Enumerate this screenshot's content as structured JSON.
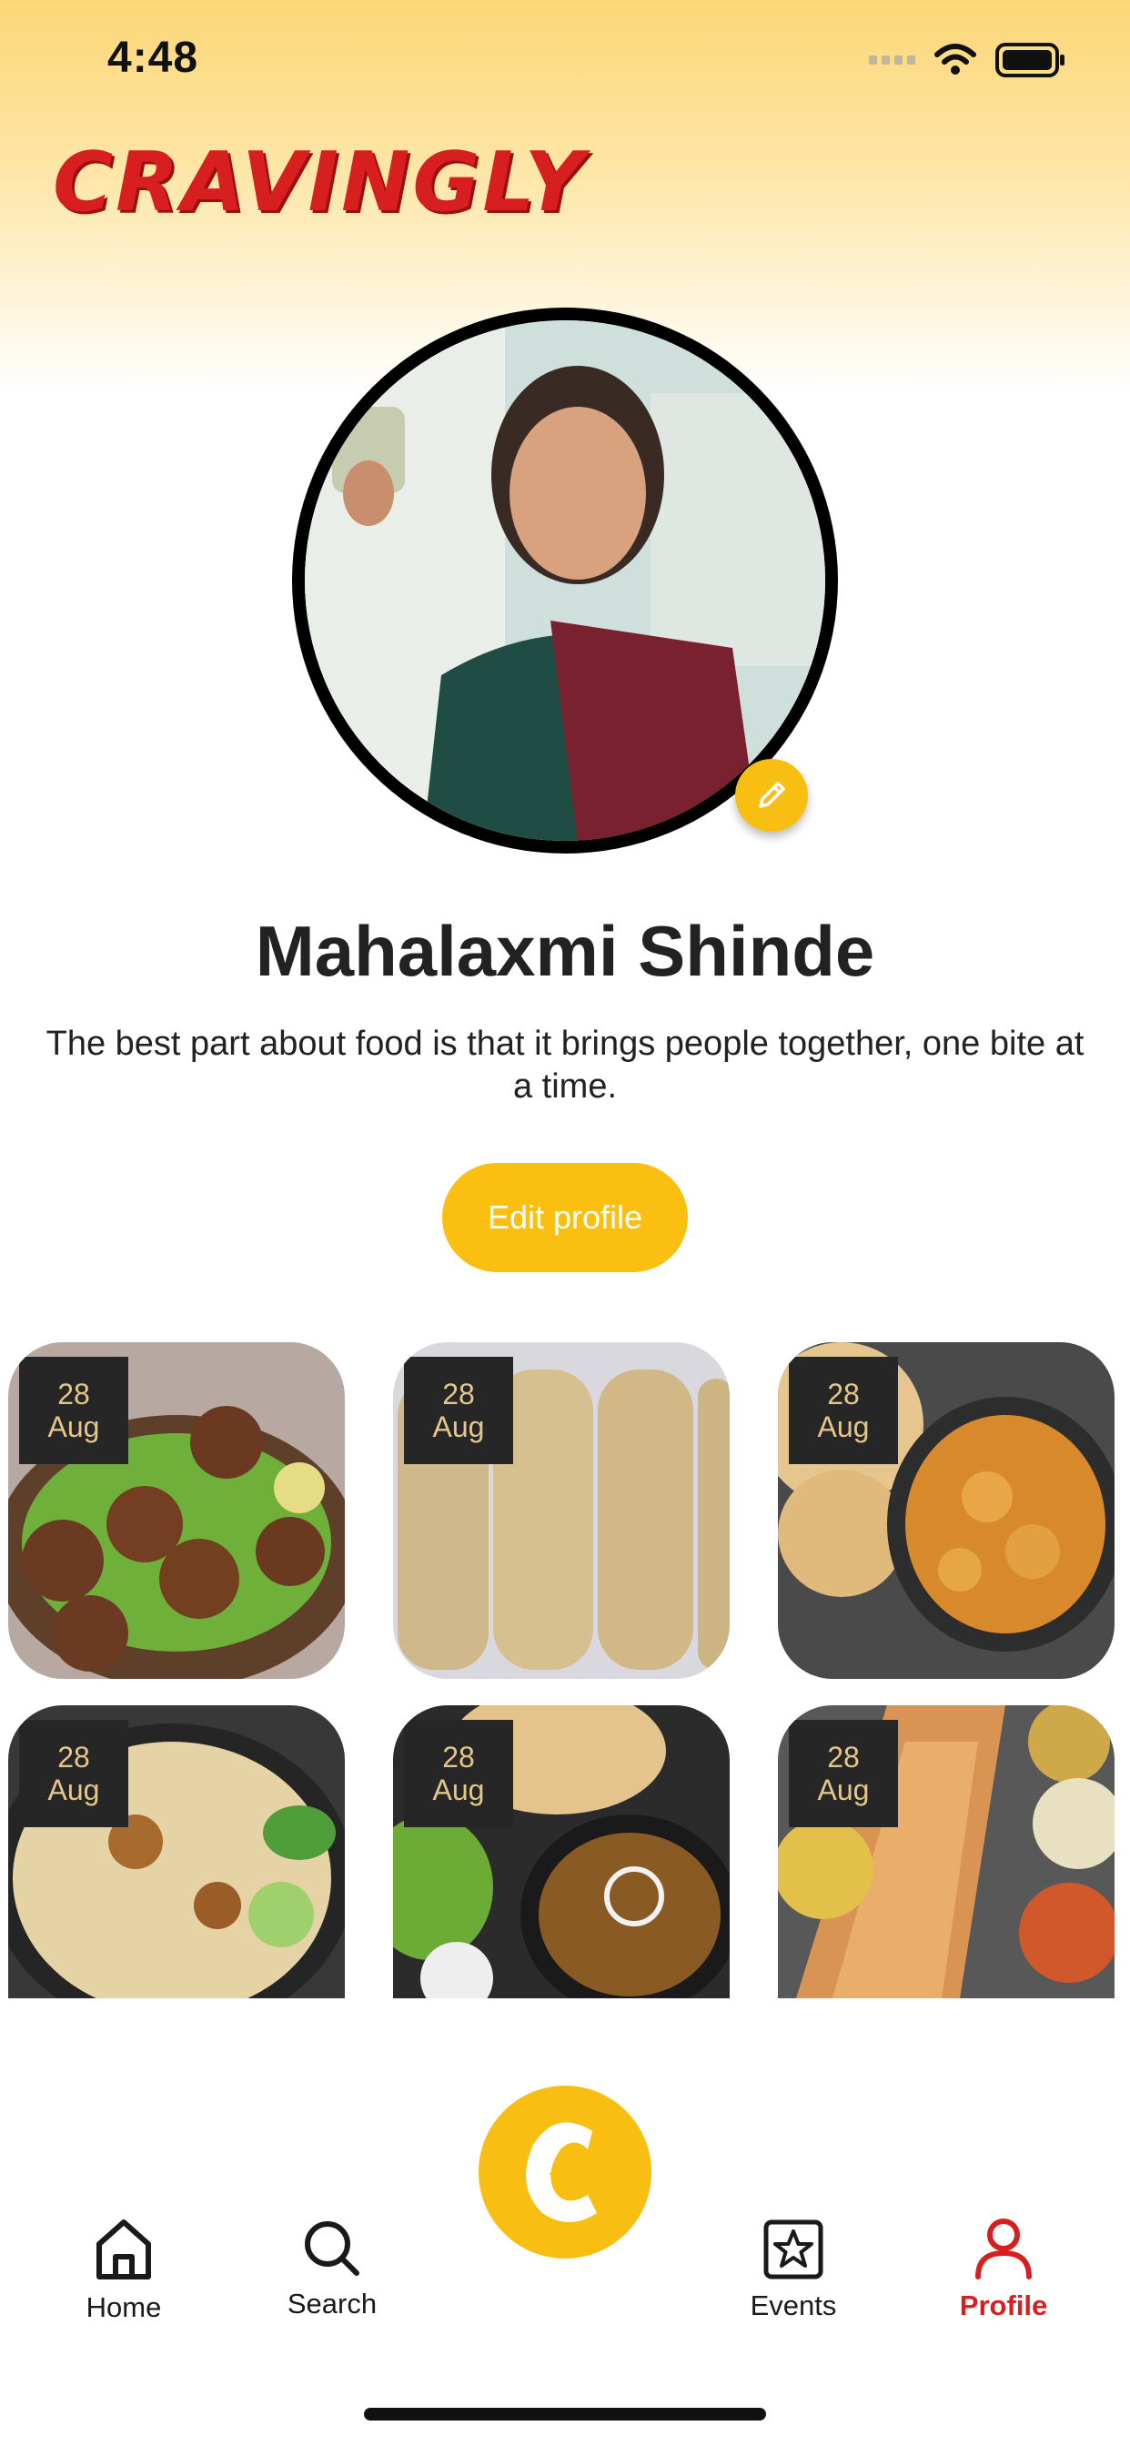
{
  "status": {
    "time": "4:48"
  },
  "app": {
    "logo": "CRAVINGLY"
  },
  "profile": {
    "name": "Mahalaxmi Shinde",
    "bio": "The best part about food is that it brings people together, one bite at a time.",
    "edit_button": "Edit profile"
  },
  "posts": [
    {
      "day": "28",
      "month": "Aug"
    },
    {
      "day": "28",
      "month": "Aug"
    },
    {
      "day": "28",
      "month": "Aug"
    },
    {
      "day": "28",
      "month": "Aug"
    },
    {
      "day": "28",
      "month": "Aug"
    },
    {
      "day": "28",
      "month": "Aug"
    }
  ],
  "nav": {
    "home": "Home",
    "search": "Search",
    "events": "Events",
    "profile": "Profile"
  },
  "colors": {
    "accent": "#fbbf11",
    "brand": "#d81f1f",
    "active": "#d71f1f"
  },
  "icons": [
    "home-icon",
    "search-icon",
    "events-star-icon",
    "profile-icon",
    "app-logo-icon",
    "pencil-icon",
    "wifi-icon",
    "battery-icon"
  ]
}
